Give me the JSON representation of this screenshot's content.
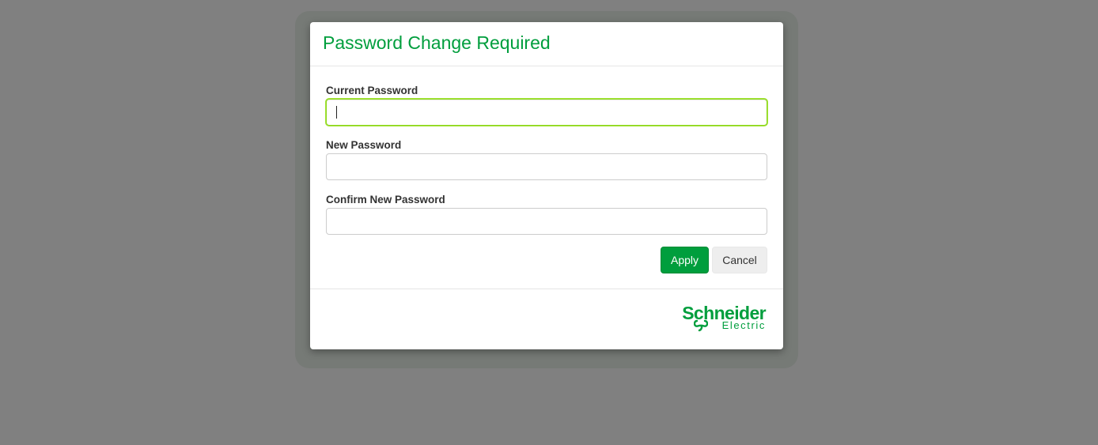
{
  "dialog": {
    "title": "Password Change Required"
  },
  "form": {
    "current_password": {
      "label": "Current Password",
      "value": "",
      "placeholder": ""
    },
    "new_password": {
      "label": "New Password",
      "value": "",
      "placeholder": ""
    },
    "confirm_password": {
      "label": "Confirm New Password",
      "value": "",
      "placeholder": ""
    }
  },
  "actions": {
    "apply_label": "Apply",
    "cancel_label": "Cancel"
  },
  "footer": {
    "logo_text": "Schneider Electric",
    "logo_line1": "Schneider",
    "logo_line2": "Electric",
    "logo_icon": "schneider-electric-logo-mark"
  },
  "colors": {
    "brand_green": "#009e3d",
    "focus_border": "#8cd41c",
    "overlay": "#808080"
  }
}
